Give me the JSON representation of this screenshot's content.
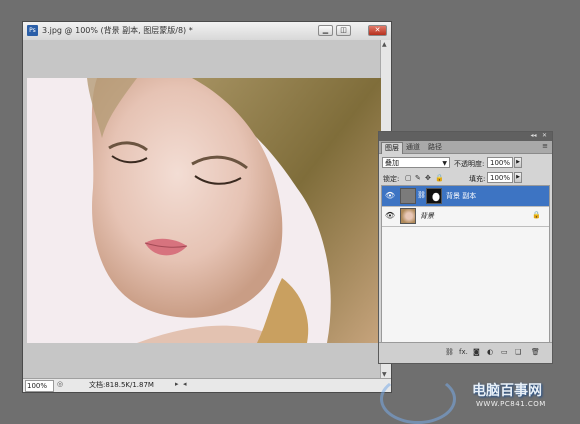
{
  "document": {
    "title": "3.jpg @ 100% (背景 副本, 图层蒙版/8) *",
    "app_icon": "Ps",
    "window_buttons": [
      "minimize-icon",
      "restore-icon",
      "close-icon"
    ],
    "status": {
      "zoom": "100%",
      "doc_size": "文档:818.5K/1.87M"
    }
  },
  "layers_panel": {
    "tabs": [
      "图层",
      "通道",
      "路径"
    ],
    "blend_mode": "叠加",
    "opacity_label": "不透明度:",
    "opacity_value": "100%",
    "lock_label": "锁定:",
    "fill_label": "填充:",
    "fill_value": "100%",
    "layers": [
      {
        "name": "背景 副本",
        "selected": true,
        "has_mask": true
      },
      {
        "name": "背景",
        "selected": false,
        "locked": true
      }
    ],
    "footer_buttons": [
      "link-layers-icon",
      "fx-icon",
      "add-mask-icon",
      "adjustment-layer-icon",
      "group-icon",
      "new-layer-icon",
      "delete-layer-icon"
    ],
    "footer_fx": "fx."
  },
  "watermark": {
    "text": "电脑百事网",
    "url": "WWW.PC841.COM"
  },
  "colors": {
    "selected_layer": "#3d74c3",
    "workspace": "#6f6f6f",
    "panel": "#d4d4d4"
  }
}
